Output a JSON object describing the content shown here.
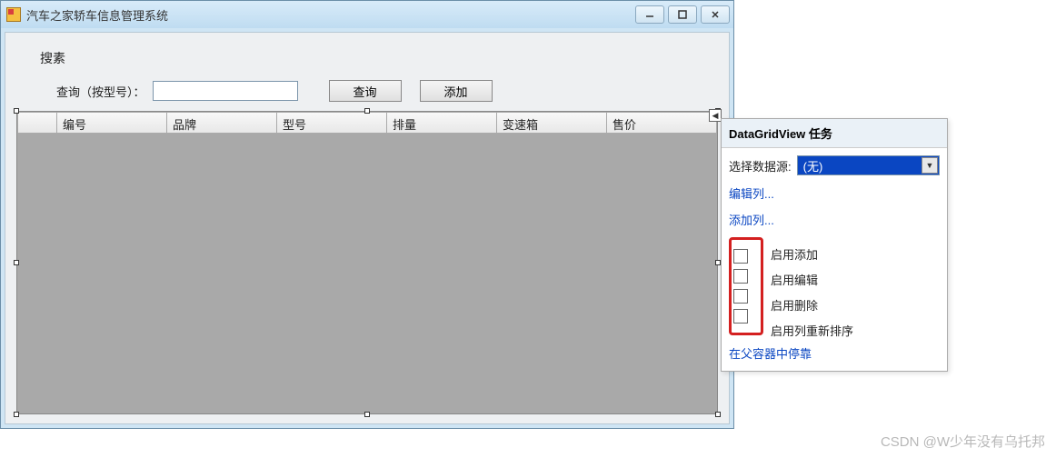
{
  "titlebar": {
    "title": "汽车之家轿车信息管理系统"
  },
  "search": {
    "section_label": "搜素",
    "query_label": "查询（按型号）：",
    "query_value": "",
    "query_button": "查询",
    "add_button": "添加"
  },
  "grid": {
    "columns": [
      "编号",
      "品牌",
      "型号",
      "排量",
      "变速箱",
      "售价"
    ]
  },
  "task_panel": {
    "title": "DataGridView 任务",
    "datasource_label": "选择数据源:",
    "datasource_value": "(无)",
    "edit_columns_link": "编辑列...",
    "add_column_link": "添加列...",
    "checkboxes": [
      {
        "label": "启用添加",
        "checked": false
      },
      {
        "label": "启用编辑",
        "checked": false
      },
      {
        "label": "启用删除",
        "checked": false
      },
      {
        "label": "启用列重新排序",
        "checked": false
      }
    ],
    "dock_link": "在父容器中停靠"
  },
  "watermark": "CSDN @W少年没有乌托邦"
}
